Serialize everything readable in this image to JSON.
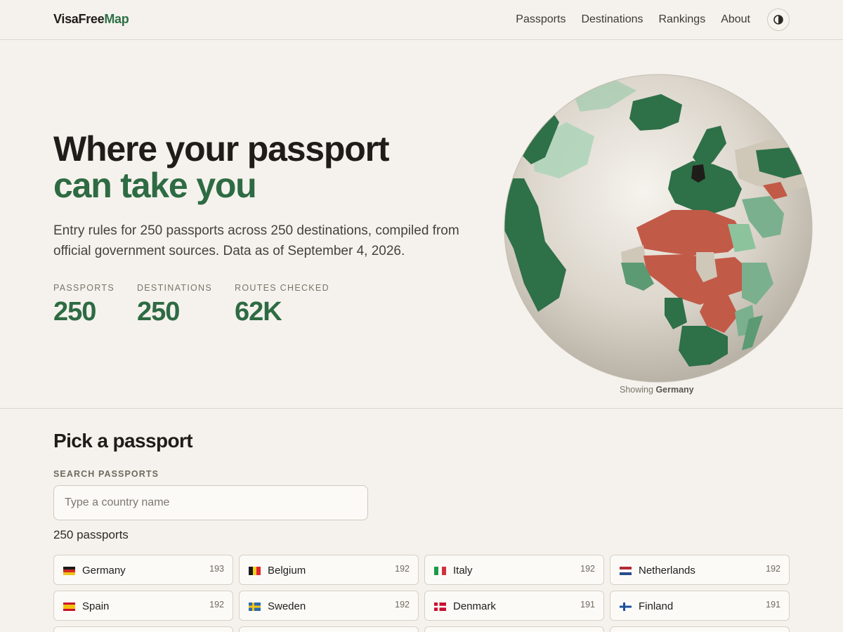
{
  "header": {
    "logo_part1": "VisaFree",
    "logo_part2": "Map",
    "nav": [
      "Passports",
      "Destinations",
      "Rankings",
      "About"
    ]
  },
  "hero": {
    "title_line1": "Where your passport",
    "title_line2": "can take you",
    "description": "Entry rules for 250 passports across 250 destinations, compiled from official government sources. Data as of September 4, 2026.",
    "stats": [
      {
        "label": "PASSPORTS",
        "value": "250"
      },
      {
        "label": "DESTINATIONS",
        "value": "250"
      },
      {
        "label": "ROUTES CHECKED",
        "value": "62K"
      }
    ],
    "globe_caption_prefix": "Showing",
    "globe_caption_country": "Germany"
  },
  "picker": {
    "title": "Pick a passport",
    "search_label": "SEARCH PASSPORTS",
    "search_placeholder": "Type a country name",
    "search_value": "",
    "count": "250 passports",
    "passports": [
      {
        "name": "Germany",
        "score": "193",
        "flag": "germany-flag-icon"
      },
      {
        "name": "Belgium",
        "score": "192",
        "flag": "belgium-flag-icon"
      },
      {
        "name": "Italy",
        "score": "192",
        "flag": "italy-flag-icon"
      },
      {
        "name": "Netherlands",
        "score": "192",
        "flag": "netherlands-flag-icon"
      },
      {
        "name": "Spain",
        "score": "192",
        "flag": "spain-flag-icon"
      },
      {
        "name": "Sweden",
        "score": "192",
        "flag": "sweden-flag-icon"
      },
      {
        "name": "Denmark",
        "score": "191",
        "flag": "denmark-flag-icon"
      },
      {
        "name": "Finland",
        "score": "191",
        "flag": "finland-flag-icon"
      }
    ]
  },
  "colors": {
    "accent": "#2e6b43",
    "visa_free": "#2e7047",
    "visa_required": "#c25a48",
    "background": "#f5f2ed"
  }
}
